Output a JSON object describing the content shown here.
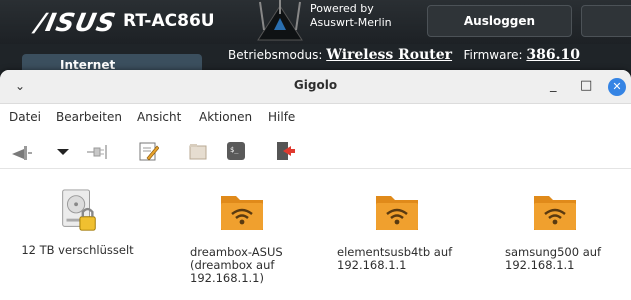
{
  "router": {
    "logo": "/ISUS",
    "model": "RT-AC86U",
    "powered_line1": "Powered by",
    "powered_line2": "Asuswrt-Merlin",
    "logout_label": "Ausloggen",
    "mode_label": "Betriebsmodus:",
    "mode_value": "Wireless Router",
    "firmware_label": "Firmware:",
    "firmware_value": "386.10",
    "internet_label": "Internet"
  },
  "window": {
    "title": "Gigolo",
    "minimize": "_",
    "maximize": "□",
    "close": "✕"
  },
  "menu": {
    "items": [
      "Datei",
      "Bearbeiten",
      "Ansicht",
      "Aktionen",
      "Hilfe"
    ]
  },
  "toolbar": {
    "icons": [
      "connect-icon",
      "dropdown-arrow-icon",
      "disconnect-icon",
      "bookmarks-edit-icon",
      "open-folder-icon",
      "terminal-icon",
      "quit-icon"
    ]
  },
  "items": [
    {
      "label": "12 TB verschlüsselt",
      "icon": "encrypted-drive-icon"
    },
    {
      "label": "dreambox-ASUS (dreambox auf 192.168.1.1)",
      "icon": "network-folder-icon"
    },
    {
      "label": "elementsusb4tb auf 192.168.1.1",
      "icon": "network-folder-icon"
    },
    {
      "label": "samsung500 auf 192.168.1.1",
      "icon": "network-folder-icon"
    }
  ],
  "colors": {
    "folder": "#f0a02e",
    "folder_dark": "#e08a1a",
    "accent_close": "#3584e4"
  }
}
